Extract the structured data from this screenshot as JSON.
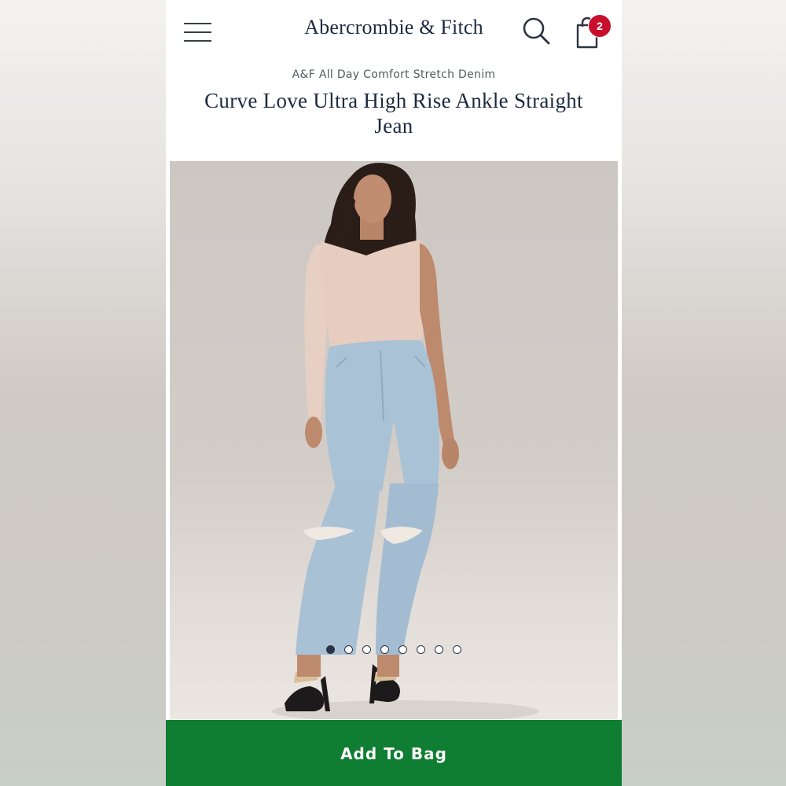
{
  "header": {
    "logo": "Abercrombie & Fitch",
    "bag_count": "2",
    "icons": {
      "menu": "hamburger-menu-icon",
      "search": "search-icon",
      "bag": "shopping-bag-icon"
    }
  },
  "product": {
    "collection": "A&F All Day Comfort Stretch Denim",
    "title": "Curve Love Ultra High Rise Ankle Straight Jean",
    "image_alt": "model wearing light wash ripped straight jeans and a pink one-shoulder ribbed top"
  },
  "carousel": {
    "total_images": 8,
    "active_index": 0
  },
  "cta": {
    "add_to_bag_label": "Add To Bag"
  },
  "colors": {
    "accent_green": "#0f7d32",
    "badge_red": "#c8102e",
    "brand_navy": "#1d2a3f"
  }
}
